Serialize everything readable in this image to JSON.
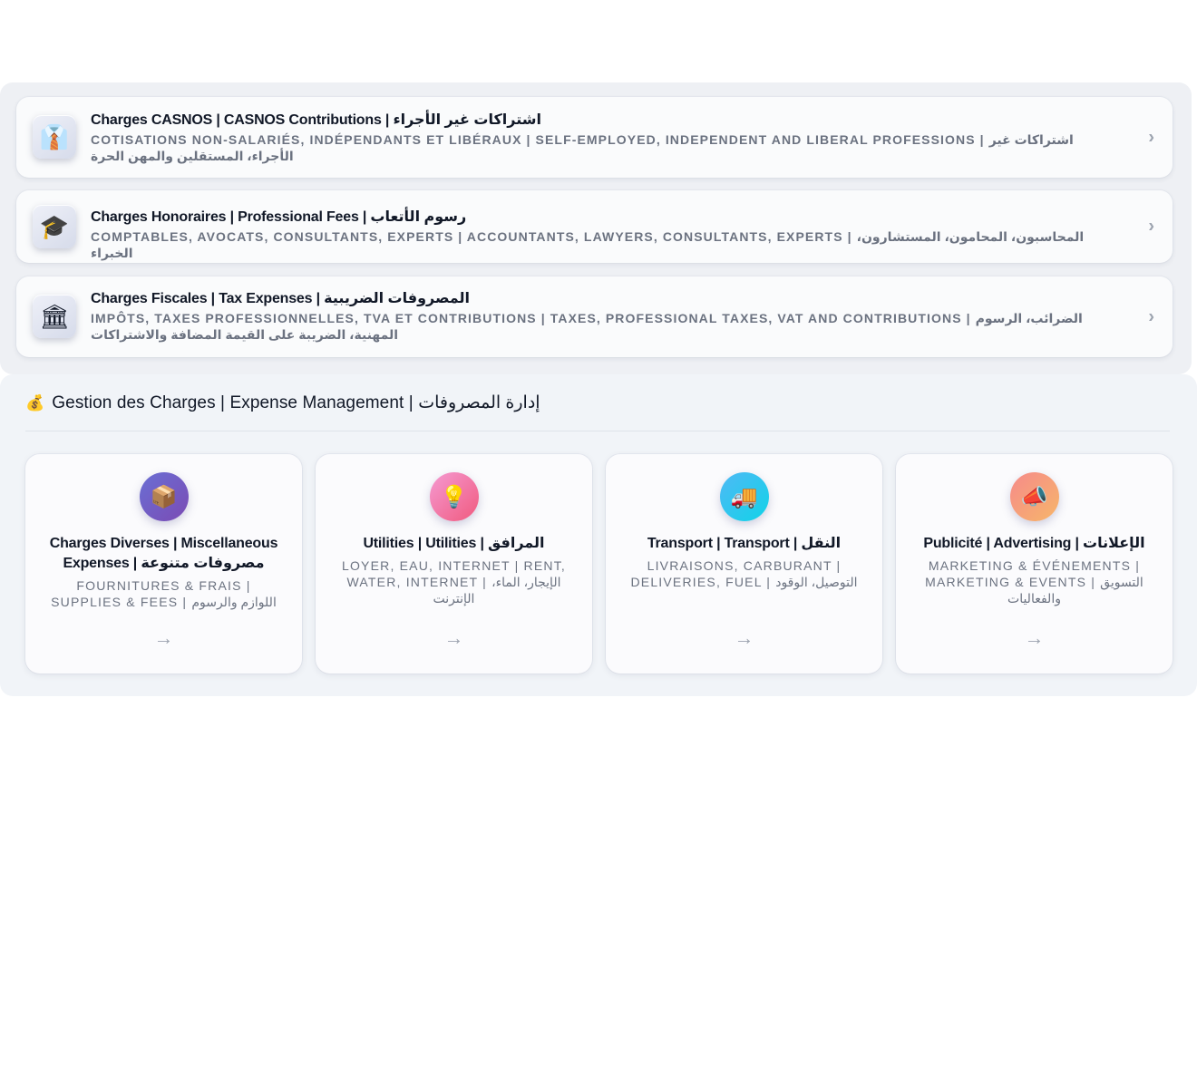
{
  "expense_list": [
    {
      "icon": "suit-icon",
      "emoji": "👔",
      "title": "Charges CASNOS | CASNOS Contributions | اشتراكات غير الأجراء",
      "subtitle": "Cotisations non-salariés, indépendants et libéraux | Self-employed, independent and liberal professions | اشتراكات غير الأجراء، المستقلين والمهن الحرة",
      "chevron": "›"
    },
    {
      "icon": "graduation-cap-icon",
      "emoji": "🎓",
      "title": "Charges Honoraires | Professional Fees | رسوم الأتعاب",
      "subtitle": "Comptables, avocats, consultants, experts | Accountants, lawyers, consultants, experts | المحاسبون، المحامون، المستشارون، الخبراء",
      "chevron": "›"
    },
    {
      "icon": "bank-icon",
      "emoji": "🏛",
      "title": "Charges Fiscales | Tax Expenses | المصروفات الضريبية",
      "subtitle": "Impôts, taxes professionnelles, TVA et contributions | Taxes, professional taxes, VAT and contributions | الضرائب، الرسوم المهنية، الضريبة على القيمة المضافة والاشتراكات",
      "chevron": "›"
    }
  ],
  "expense_management": {
    "header_icon": "💰",
    "header": "Gestion des Charges | Expense Management | إدارة المصروفات",
    "tiles": [
      {
        "icon": "package-icon",
        "emoji": "📦",
        "title": "Charges Diverses | Miscellaneous Expenses | مصروفات متنوعة",
        "subtitle": "Fournitures & frais | Supplies & fees | اللوازم والرسوم",
        "arrow": "→"
      },
      {
        "icon": "light-bulb-icon",
        "emoji": "💡",
        "title": "Utilities | Utilities | المرافق",
        "subtitle": "Loyer, eau, internet | Rent, water, internet | الإيجار، الماء، الإنترنت",
        "arrow": "→"
      },
      {
        "icon": "truck-icon",
        "emoji": "🚚",
        "title": "Transport | Transport | النقل",
        "subtitle": "Livraisons, carburant | Deliveries, fuel | التوصيل، الوقود",
        "arrow": "→"
      },
      {
        "icon": "megaphone-icon",
        "emoji": "📣",
        "title": "Publicité | Advertising | الإعلانات",
        "subtitle": "Marketing & événements | Marketing & events | التسويق والفعاليات",
        "arrow": "→"
      }
    ]
  }
}
